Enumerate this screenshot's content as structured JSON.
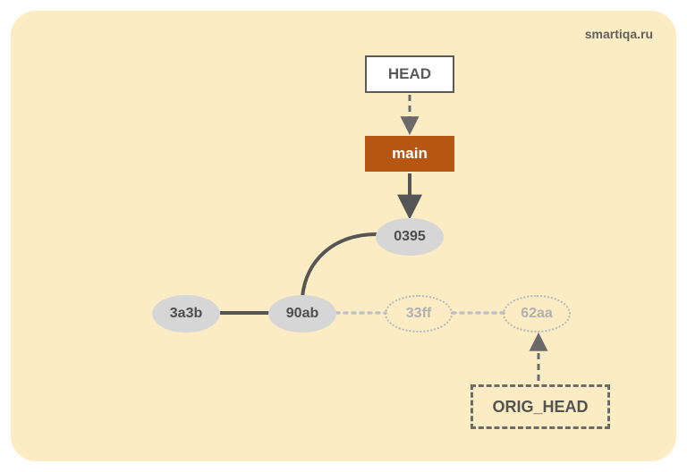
{
  "watermark": "smartiqa.ru",
  "refs": {
    "head": "HEAD",
    "main": "main",
    "orig_head": "ORIG_HEAD"
  },
  "commits": {
    "c0395": "0395",
    "c3a3b": "3a3b",
    "c90ab": "90ab",
    "c33ff": "33ff",
    "c62aa": "62aa"
  }
}
